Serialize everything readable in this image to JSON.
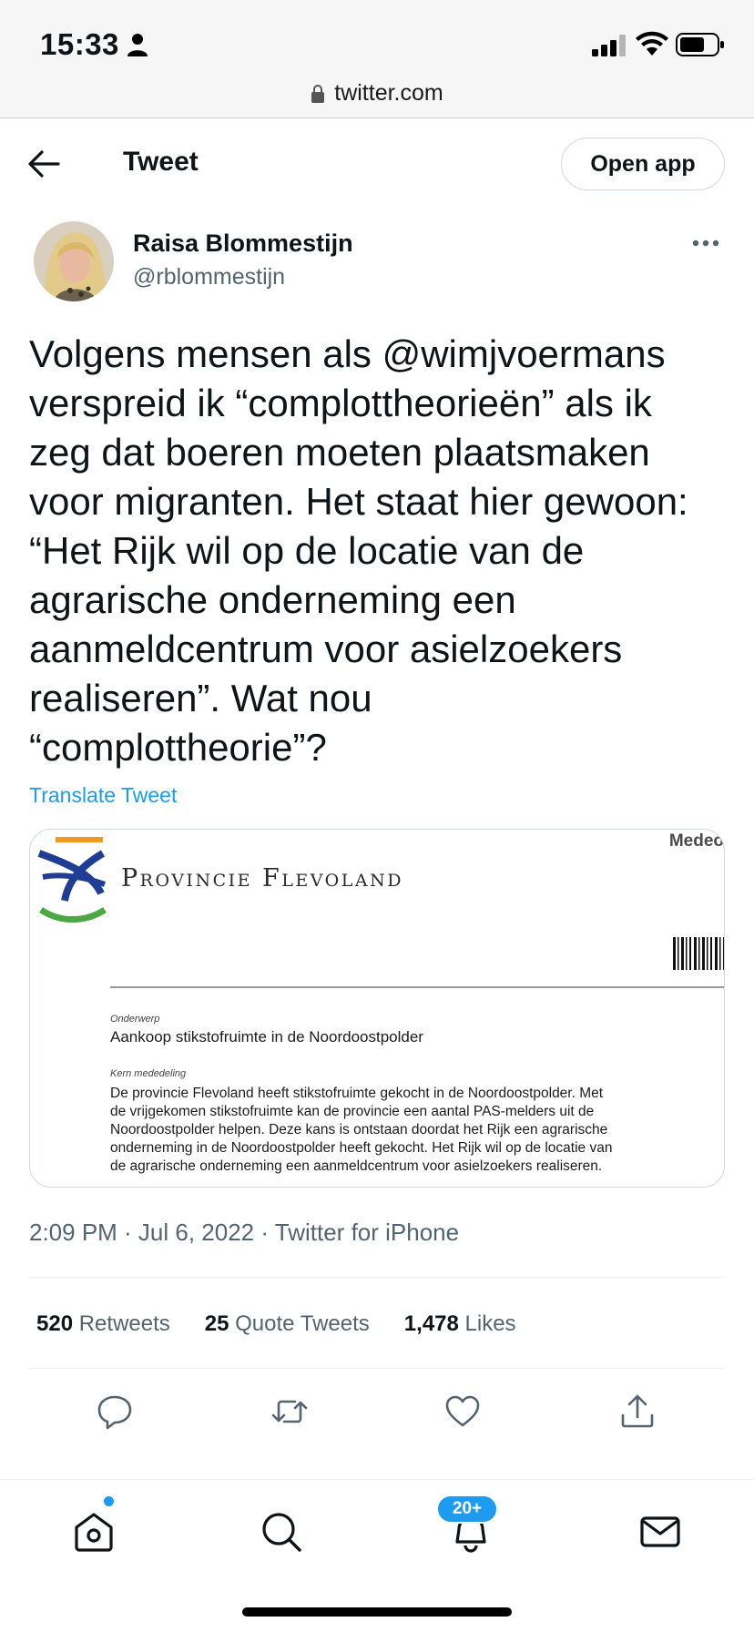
{
  "status_bar": {
    "time": "15:33",
    "url": "twitter.com"
  },
  "header": {
    "title": "Tweet",
    "open_app_label": "Open app"
  },
  "author": {
    "name": "Raisa Blommestijn",
    "handle": "@rblommestijn"
  },
  "tweet": {
    "text": "Volgens mensen als @wimjvoermans\nverspreid ik “complottheorieën” als ik\nzeg dat boeren moeten plaatsmaken\nvoor migranten. Het staat hier gewoon:\n“Het Rijk wil op de locatie van de\nagrarische onderneming een\naanmeldcentrum voor asielzoekers\nrealiseren”. Wat nou\n“complottheorie”?",
    "translate_label": "Translate Tweet"
  },
  "media": {
    "header_label": "Medeo",
    "org_name": "Provincie Flevoland",
    "subject_label": "Onderwerp",
    "subject": "Aankoop stikstofruimte in de Noordoostpolder",
    "body_label": "Kern mededeling",
    "body": "De provincie Flevoland heeft stikstofruimte gekocht in de Noordoostpolder. Met\nde vrijgekomen stikstofruimte kan de provincie een aantal PAS-melders uit de\nNoordoostpolder helpen. Deze kans is ontstaan doordat het Rijk een agrarische\nonderneming in de Noordoostpolder heeft gekocht. Het Rijk wil op de locatie van\nde agrarische onderneming een aanmeldcentrum voor asielzoekers realiseren."
  },
  "meta": {
    "text": "2:09 PM · Jul 6, 2022 · Twitter for iPhone"
  },
  "stats": {
    "retweets_count": "520",
    "retweets_label": "Retweets",
    "quotes_count": "25",
    "quotes_label": "Quote Tweets",
    "likes_count": "1,478",
    "likes_label": "Likes"
  },
  "bottom_nav": {
    "notifications_badge": "20+"
  },
  "colors": {
    "accent": "#1d9bf0",
    "text": "#0f1419",
    "secondary": "#536471",
    "border": "#cfd9de"
  }
}
